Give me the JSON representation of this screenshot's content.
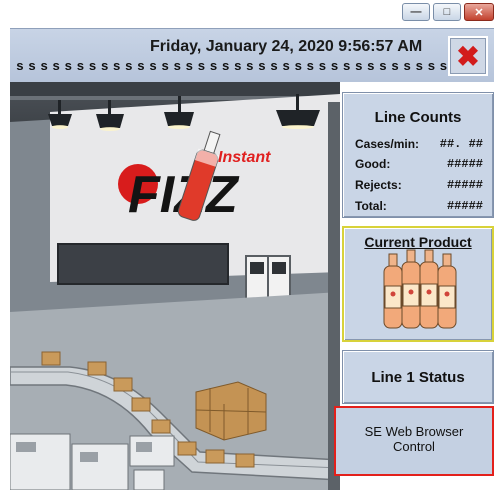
{
  "window_controls": {
    "minimize_glyph": "—",
    "maximize_glyph": "□",
    "close_glyph": "✕"
  },
  "header": {
    "datetime": "Friday, January 24, 2020 9:56:57 AM",
    "ticker": "ssssssssssssssssssssssssssssssssssss",
    "close_glyph": "✖"
  },
  "scene": {
    "brand_word": "Instant",
    "brand_logo": "FIZZ"
  },
  "line_counts": {
    "title": "Line Counts",
    "rows": [
      {
        "label": "Cases/min:",
        "value": "##. ##"
      },
      {
        "label": "Good:",
        "value": "#####"
      },
      {
        "label": "Rejects:",
        "value": "#####"
      },
      {
        "label": "Total:",
        "value": "#####"
      }
    ]
  },
  "current_product": {
    "title": "Current Product"
  },
  "line_status": {
    "title": "Line 1 Status"
  },
  "browser_control": {
    "line1": "SE Web Browser",
    "line2": "Control"
  },
  "colors": {
    "accent_red": "#d21c1c",
    "panel_blue": "#c9d5e6",
    "highlight_yellow": "#d8d23a",
    "border_red": "#e3201b"
  }
}
